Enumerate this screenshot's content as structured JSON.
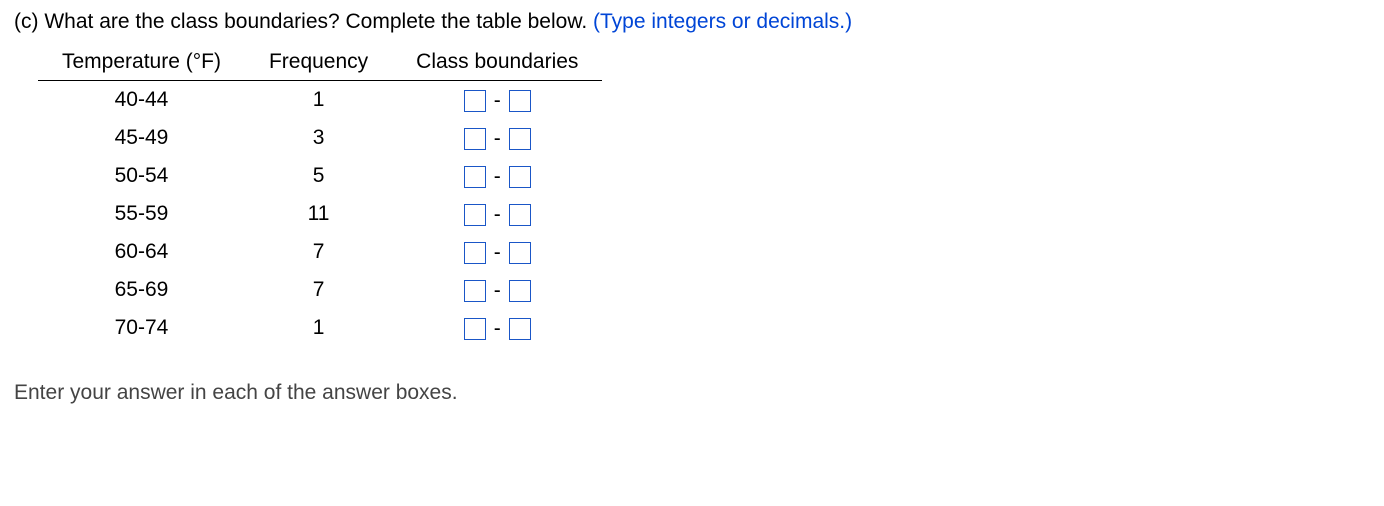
{
  "question": {
    "part_label": "(c)",
    "text": "What are the class boundaries? Complete the table below.",
    "hint": "(Type integers or decimals.)"
  },
  "table": {
    "headers": {
      "col1": "Temperature (°F)",
      "col2": "Frequency",
      "col3": "Class boundaries"
    },
    "rows": [
      {
        "range": "40-44",
        "freq": "1",
        "low": "",
        "high": ""
      },
      {
        "range": "45-49",
        "freq": "3",
        "low": "",
        "high": ""
      },
      {
        "range": "50-54",
        "freq": "5",
        "low": "",
        "high": ""
      },
      {
        "range": "55-59",
        "freq": "11",
        "low": "",
        "high": ""
      },
      {
        "range": "60-64",
        "freq": "7",
        "low": "",
        "high": ""
      },
      {
        "range": "65-69",
        "freq": "7",
        "low": "",
        "high": ""
      },
      {
        "range": "70-74",
        "freq": "1",
        "low": "",
        "high": ""
      }
    ],
    "separator": "-"
  },
  "footer": "Enter your answer in each of the answer boxes."
}
